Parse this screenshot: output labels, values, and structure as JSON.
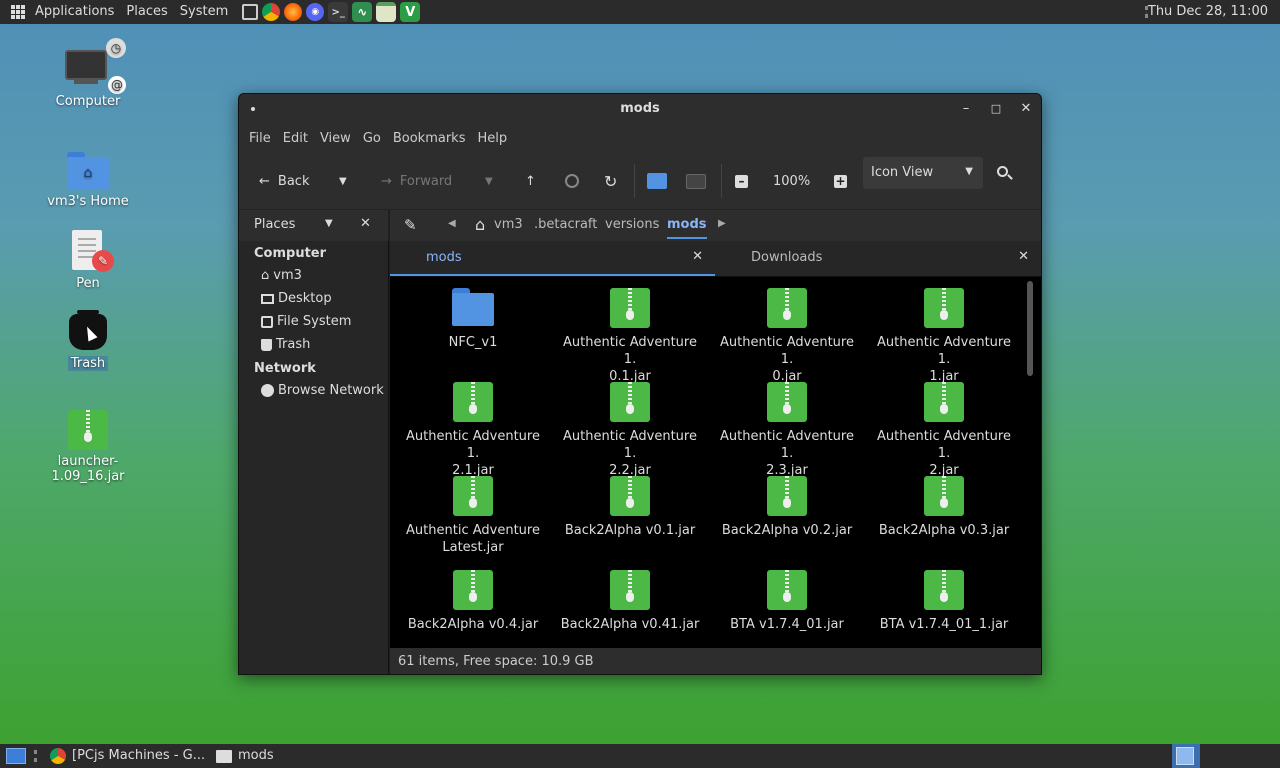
{
  "top_panel": {
    "menus": [
      "Applications",
      "Places",
      "System"
    ],
    "clock": "Thu Dec 28, 11:00"
  },
  "desktop": {
    "icons": [
      {
        "label": "Computer"
      },
      {
        "label": "vm3's Home"
      },
      {
        "label": "Pen"
      },
      {
        "label": "Trash"
      },
      {
        "label": "launcher-1.09_16.jar"
      }
    ]
  },
  "window": {
    "title": "mods",
    "menu": [
      "File",
      "Edit",
      "View",
      "Go",
      "Bookmarks",
      "Help"
    ],
    "toolbar": {
      "back": "Back",
      "forward": "Forward",
      "zoom": "100%",
      "view_mode": "Icon View"
    },
    "sidebar": {
      "header": "Places",
      "sections": [
        {
          "title": "Computer",
          "items": [
            "vm3",
            "Desktop",
            "File System",
            "Trash"
          ]
        },
        {
          "title": "Network",
          "items": [
            "Browse Network"
          ]
        }
      ]
    },
    "breadcrumb": [
      "vm3",
      ".betacraft",
      "versions",
      "mods"
    ],
    "tabs": [
      {
        "label": "mods",
        "active": true
      },
      {
        "label": "Downloads",
        "active": false
      }
    ],
    "files": [
      {
        "name": "NFC_v1",
        "type": "folder"
      },
      {
        "name": "Authentic Adventure 1.0.1.jar",
        "line1": "Authentic Adventure 1.",
        "line2": "0.1.jar",
        "type": "jar"
      },
      {
        "name": "Authentic Adventure 1.0.jar",
        "line1": "Authentic Adventure 1.",
        "line2": "0.jar",
        "type": "jar"
      },
      {
        "name": "Authentic Adventure 1.1.jar",
        "line1": "Authentic Adventure 1.",
        "line2": "1.jar",
        "type": "jar"
      },
      {
        "name": "Authentic Adventure 1.2.1.jar",
        "line1": "Authentic Adventure 1.",
        "line2": "2.1.jar",
        "type": "jar"
      },
      {
        "name": "Authentic Adventure 1.2.2.jar",
        "line1": "Authentic Adventure 1.",
        "line2": "2.2.jar",
        "type": "jar"
      },
      {
        "name": "Authentic Adventure 1.2.3.jar",
        "line1": "Authentic Adventure 1.",
        "line2": "2.3.jar",
        "type": "jar"
      },
      {
        "name": "Authentic Adventure 1.2.jar",
        "line1": "Authentic Adventure 1.",
        "line2": "2.jar",
        "type": "jar"
      },
      {
        "name": "Authentic Adventure Latest.jar",
        "line1": "Authentic Adventure",
        "line2": "Latest.jar",
        "type": "jar"
      },
      {
        "name": "Back2Alpha v0.1.jar",
        "line1": "Back2Alpha v0.1.jar",
        "line2": "",
        "type": "jar"
      },
      {
        "name": "Back2Alpha v0.2.jar",
        "line1": "Back2Alpha v0.2.jar",
        "line2": "",
        "type": "jar"
      },
      {
        "name": "Back2Alpha v0.3.jar",
        "line1": "Back2Alpha v0.3.jar",
        "line2": "",
        "type": "jar"
      },
      {
        "name": "Back2Alpha v0.4.jar",
        "line1": "Back2Alpha v0.4.jar",
        "line2": "",
        "type": "jar"
      },
      {
        "name": "Back2Alpha v0.41.jar",
        "line1": "Back2Alpha v0.41.jar",
        "line2": "",
        "type": "jar"
      },
      {
        "name": "BTA v1.7.4_01.jar",
        "line1": "BTA v1.7.4_01.jar",
        "line2": "",
        "type": "jar"
      },
      {
        "name": "BTA v1.7.4_01_1.jar",
        "line1": "BTA v1.7.4_01_1.jar",
        "line2": "",
        "type": "jar"
      }
    ],
    "status": "61 items, Free space: 10.9 GB"
  },
  "bottom_panel": {
    "tasks": [
      "[PCjs Machines - G...",
      "mods"
    ]
  }
}
